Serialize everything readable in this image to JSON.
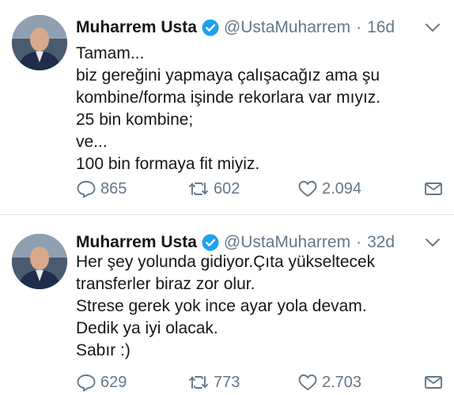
{
  "tweets": [
    {
      "author_name": "Muharrem Usta",
      "handle": "@UstaMuharrem",
      "separator": "·",
      "time": "16d",
      "lines": [
        "Tamam...",
        "biz gereğini yapmaya çalışacağız ama şu",
        "kombine/forma işinde rekorlara var mıyız.",
        "25 bin kombine;",
        "ve...",
        "100 bin formaya fit miyiz."
      ],
      "replies": "865",
      "retweets": "602",
      "likes": "2.094"
    },
    {
      "author_name": "Muharrem Usta",
      "handle": "@UstaMuharrem",
      "separator": "·",
      "time": "32d",
      "lines": [
        "Her şey yolunda gidiyor.Çıta yükseltecek",
        "transferler biraz zor olur.",
        "Strese gerek yok ince ayar yola devam.",
        "Dedik ya iyi olacak.",
        "Sabır :)"
      ],
      "replies": "629",
      "retweets": "773",
      "likes": "2.703"
    }
  ],
  "colors": {
    "text": "#14171a",
    "muted": "#657786",
    "verified": "#1da1f2",
    "divider": "#dfe3e6"
  },
  "icons": [
    "verified-badge-icon",
    "chevron-down-icon",
    "reply-icon",
    "retweet-icon",
    "like-icon",
    "direct-message-icon"
  ]
}
